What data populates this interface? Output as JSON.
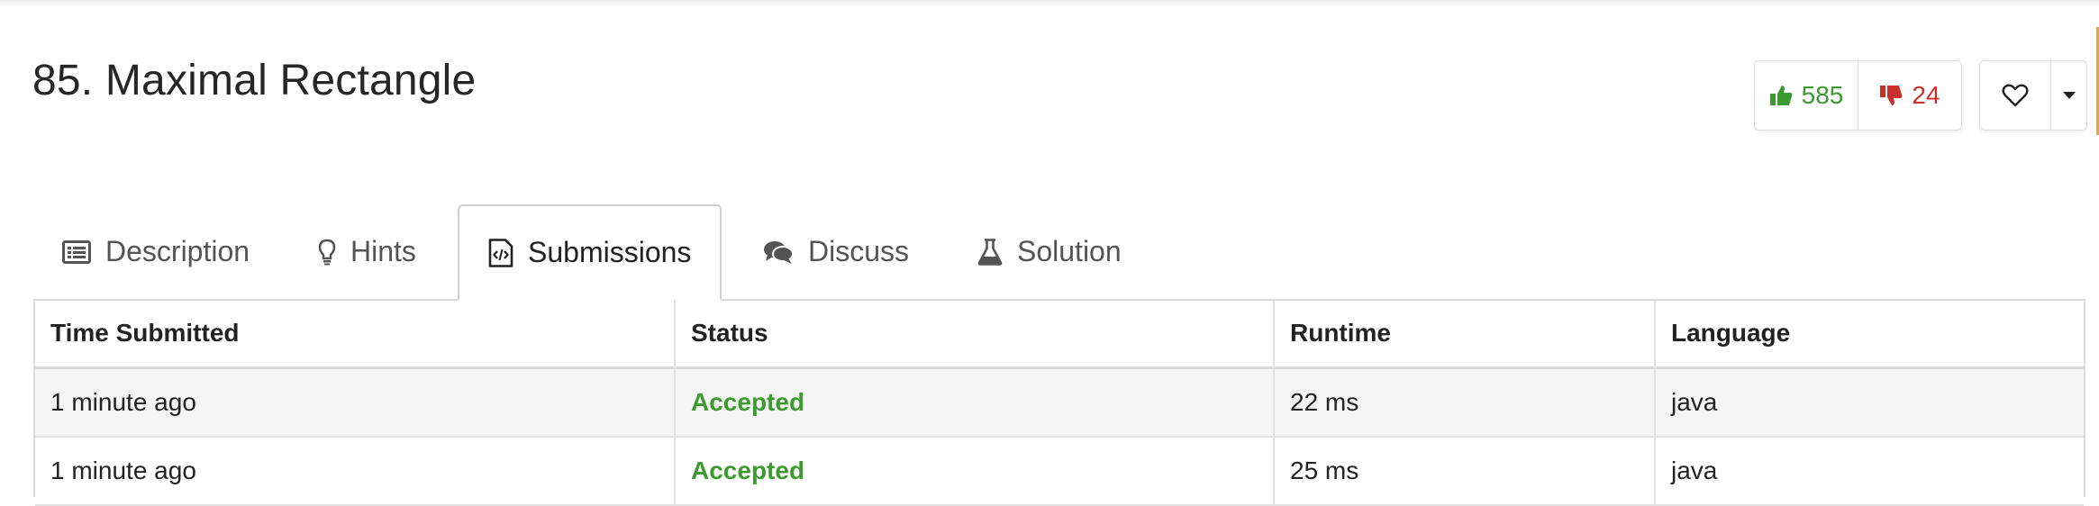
{
  "problem": {
    "title": "85. Maximal Rectangle"
  },
  "votes": {
    "likes": "585",
    "dislikes": "24"
  },
  "tabs": [
    {
      "label": "Description",
      "icon": "list-icon"
    },
    {
      "label": "Hints",
      "icon": "lightbulb-icon"
    },
    {
      "label": "Submissions",
      "icon": "code-file-icon",
      "active": true
    },
    {
      "label": "Discuss",
      "icon": "comments-icon"
    },
    {
      "label": "Solution",
      "icon": "flask-icon"
    }
  ],
  "table": {
    "headers": [
      "Time Submitted",
      "Status",
      "Runtime",
      "Language"
    ],
    "rows": [
      [
        "1 minute ago",
        "Accepted",
        "22 ms",
        "java"
      ],
      [
        "1 minute ago",
        "Accepted",
        "25 ms",
        "java"
      ]
    ]
  },
  "colors": {
    "accepted": "#3c9a2f",
    "like": "#3a9a32",
    "dislike": "#c9302c"
  }
}
